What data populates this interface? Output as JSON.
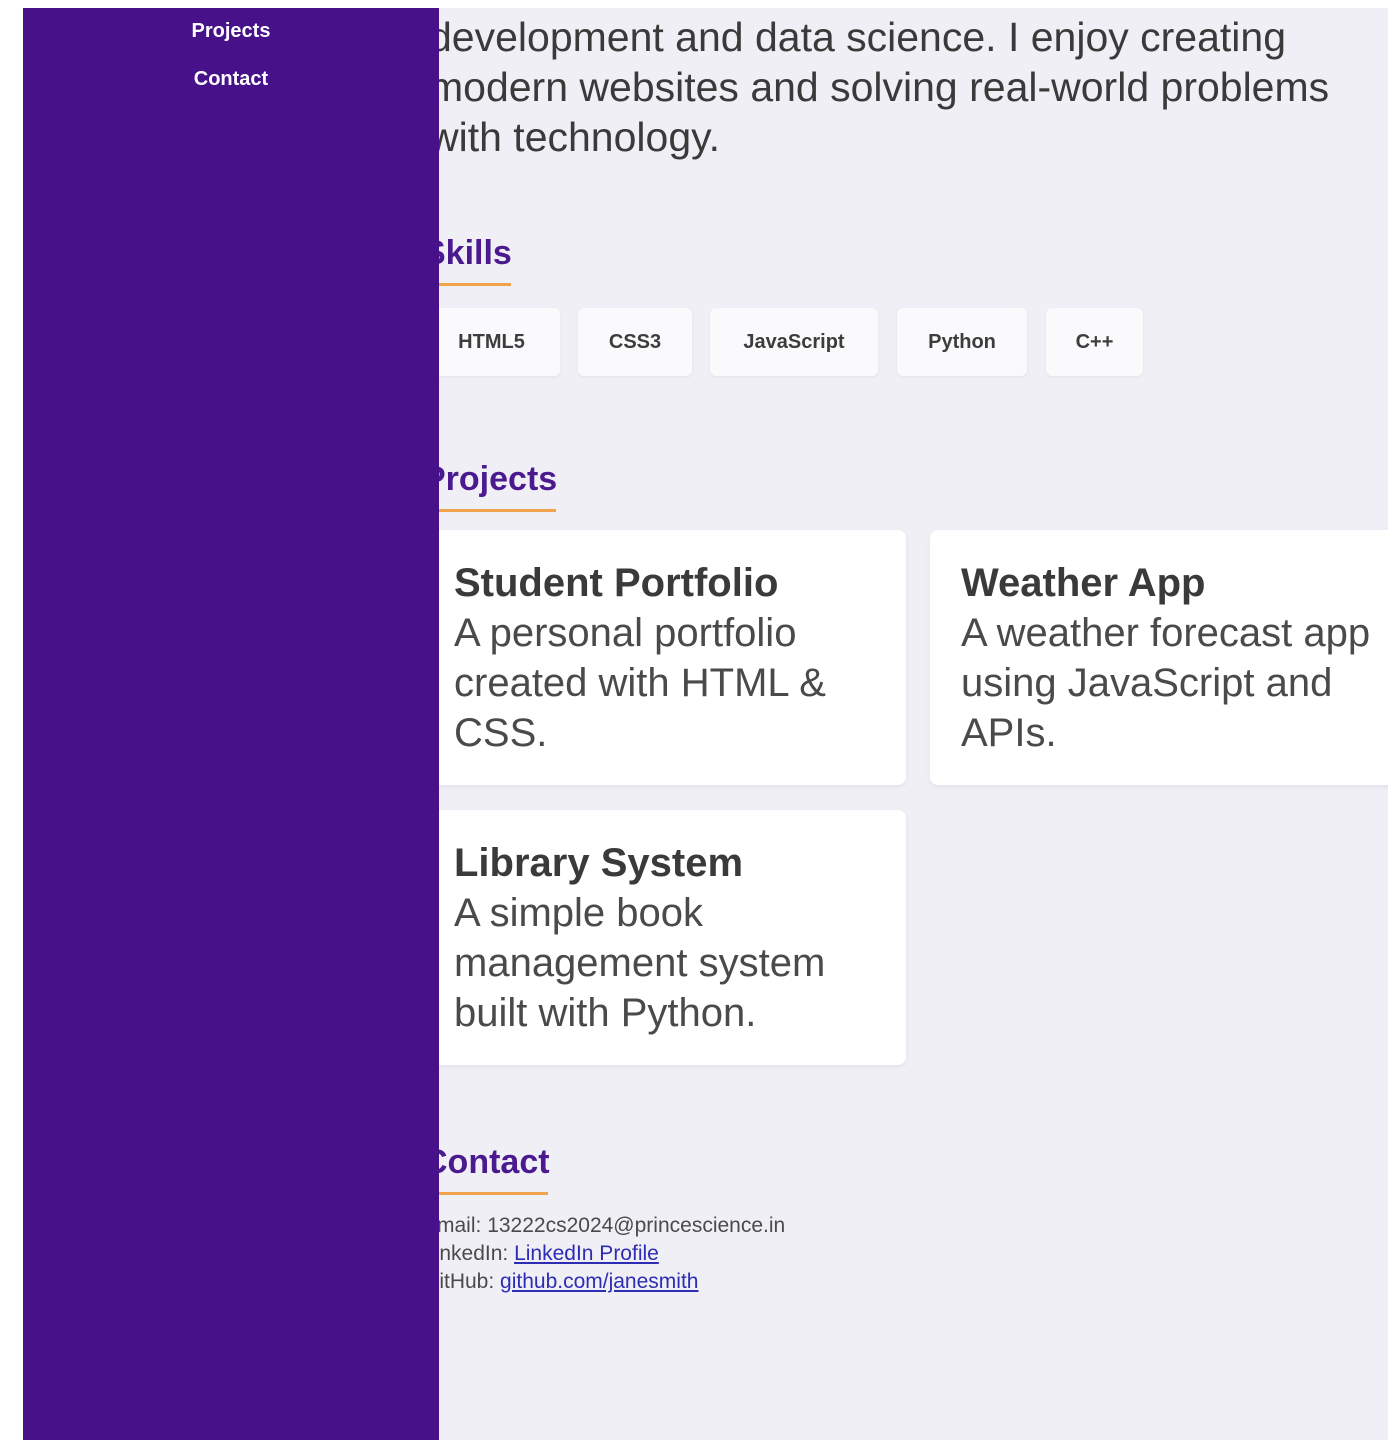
{
  "sidebar": {
    "nav": [
      {
        "label": "Projects"
      },
      {
        "label": "Contact"
      }
    ]
  },
  "about": {
    "text": "development and data science. I enjoy creating modern websites and solving real-world problems with technology."
  },
  "skills": {
    "title": "Skills",
    "items": [
      "HTML5",
      "CSS3",
      "JavaScript",
      "Python",
      "C++"
    ]
  },
  "projects": {
    "title": "Projects",
    "items": [
      {
        "title": "Student Portfolio",
        "description": "A personal portfolio created with HTML & CSS."
      },
      {
        "title": "Weather App",
        "description": "A weather forecast app using JavaScript and APIs."
      },
      {
        "title": "Library System",
        "description": "A simple book management system built with Python."
      }
    ]
  },
  "contact": {
    "title": "Contact",
    "email_label": "Email: ",
    "email_value": "13222cs2024@princescience.in",
    "linkedin_label": "LinkedIn: ",
    "linkedin_link": "LinkedIn Profile",
    "github_label": "GitHub: ",
    "github_link": "github.com/janesmith"
  },
  "colors": {
    "sidebar_bg": "#461189",
    "heading": "#4b1a8f",
    "accent_underline": "#f0a34a",
    "page_bg": "#f0eff6"
  }
}
